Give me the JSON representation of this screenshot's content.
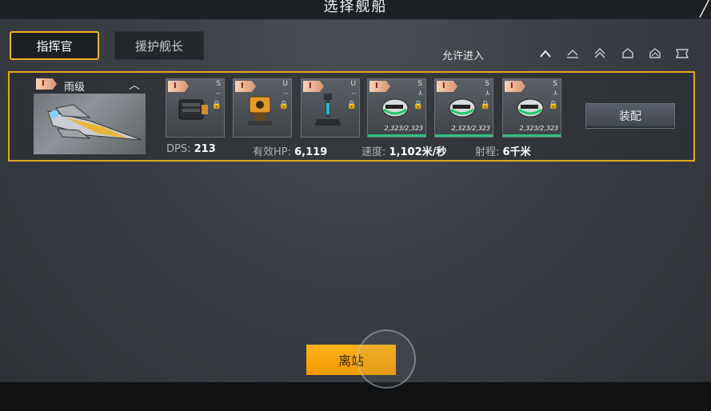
{
  "header": {
    "title": "选择舰船",
    "close_icon": "close-icon"
  },
  "tabs": [
    {
      "label": "指挥官",
      "active": true
    },
    {
      "label": "援护舰长",
      "active": false
    }
  ],
  "filter": {
    "label": "允许进入",
    "icons": [
      "chevron-up-icon",
      "rank-1-icon",
      "rank-2-icon",
      "rank-3-icon",
      "rank-4-icon",
      "rank-5-icon"
    ]
  },
  "ship": {
    "tier": "I",
    "class_name": "雨级",
    "modules": [
      {
        "tier": "I",
        "slot": "S",
        "dash": "--",
        "hp": "",
        "type": "engine"
      },
      {
        "tier": "I",
        "slot": "U",
        "dash": "--",
        "hp": "",
        "type": "turret"
      },
      {
        "tier": "I",
        "slot": "U",
        "dash": "--",
        "hp": "",
        "type": "tower"
      },
      {
        "tier": "I",
        "slot": "S",
        "dash": "",
        "hp": "2,323/2,323",
        "type": "fighter"
      },
      {
        "tier": "I",
        "slot": "S",
        "dash": "",
        "hp": "2,323/2,323",
        "type": "fighter"
      },
      {
        "tier": "I",
        "slot": "S",
        "dash": "",
        "hp": "2,323/2,323",
        "type": "fighter"
      }
    ],
    "equip_label": "装配",
    "stats": {
      "dps_label": "DPS:",
      "dps_value": "213",
      "hp_label": "有效HP:",
      "hp_value": "6,119",
      "speed_label": "速度:",
      "speed_value": "1,102米/秒",
      "range_label": "射程:",
      "range_value": "6千米"
    }
  },
  "footer": {
    "depart_label": "离站"
  },
  "colors": {
    "accent": "#f0b41e",
    "depart": "#ffa800",
    "hp_bar": "#2ec27e"
  }
}
